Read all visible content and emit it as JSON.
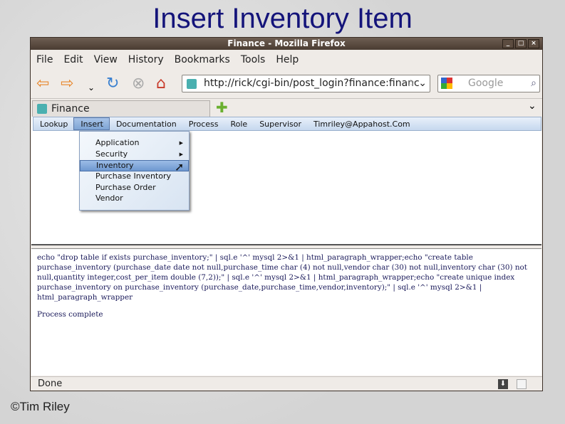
{
  "slide": {
    "title": "Insert Inventory Item",
    "copyright": "©Tim Riley"
  },
  "window": {
    "title": "Finance - Mozilla Firefox"
  },
  "menubar": [
    "File",
    "Edit",
    "View",
    "History",
    "Bookmarks",
    "Tools",
    "Help"
  ],
  "navbar": {
    "url": "http://rick/cgi-bin/post_login?finance:financ",
    "search_placeholder": "Google"
  },
  "tab": {
    "label": "Finance"
  },
  "appmenu": [
    "Lookup",
    "Insert",
    "Documentation",
    "Process",
    "Role",
    "Supervisor",
    "Timriley@Appahost.Com"
  ],
  "dropdown": [
    {
      "label": "Application",
      "submenu": true
    },
    {
      "label": "Security",
      "submenu": true
    },
    {
      "label": "Inventory",
      "highlighted": true
    },
    {
      "label": "Purchase Inventory"
    },
    {
      "label": "Purchase Order"
    },
    {
      "label": "Vendor"
    }
  ],
  "output": {
    "command": "echo \"drop table if exists purchase_inventory;\" | sql.e '^' mysql 2>&1 | html_paragraph_wrapper;echo \"create table purchase_inventory (purchase_date date not null,purchase_time char (4) not null,vendor char (30) not null,inventory char (30) not null,quantity integer,cost_per_item double (7,2));\" | sql.e '^' mysql 2>&1 | html_paragraph_wrapper;echo \"create unique index purchase_inventory on purchase_inventory (purchase_date,purchase_time,vendor,inventory);\" | sql.e '^' mysql 2>&1 | html_paragraph_wrapper",
    "result": "Process complete"
  },
  "status": "Done"
}
